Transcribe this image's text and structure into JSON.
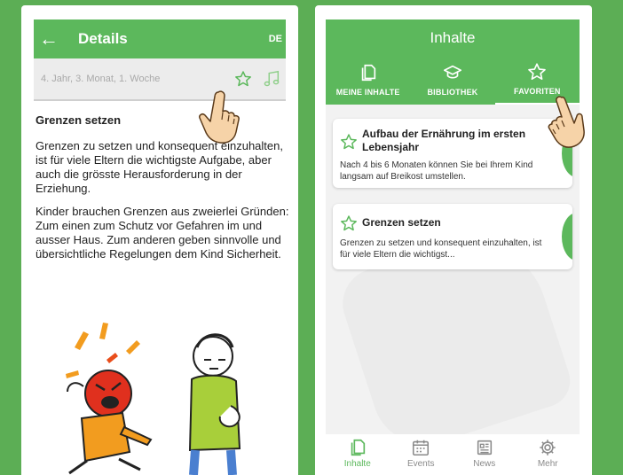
{
  "left_screen": {
    "header": {
      "title": "Details",
      "lang": "DE",
      "back_icon": "arrow-left-icon"
    },
    "age_label": "4. Jahr, 3. Monat, 1. Woche",
    "article": {
      "title": "Grenzen setzen",
      "paragraph1": "Grenzen zu setzen und konsequent einzuhalten, ist für viele Eltern die wichtigste Aufgabe, aber auch die grösste Herausforderung in der Erziehung.",
      "paragraph2": "Kinder brauchen Grenzen aus zweierlei Gründen: Zum einen zum Schutz vor Gefahren im und ausser Haus. Zum anderen geben sinnvolle und übersichtliche Regelungen dem Kind Sicherheit."
    }
  },
  "right_screen": {
    "header": {
      "title": "Inhalte"
    },
    "tabs": [
      {
        "label": "MEINE INHALTE",
        "icon": "documents-icon"
      },
      {
        "label": "BIBLIOTHEK",
        "icon": "graduation-cap-icon"
      },
      {
        "label": "FAVORITEN",
        "icon": "star-icon"
      }
    ],
    "cards": [
      {
        "title": "Aufbau der Ernährung im ersten Lebensjahr",
        "text": "Nach 4 bis 6 Monaten können Sie bei Ihrem Kind langsam auf Breikost umstellen."
      },
      {
        "title": "Grenzen setzen",
        "text": "Grenzen zu setzen und konsequent einzuhalten, ist für viele Eltern die wichtigst..."
      }
    ],
    "nav": [
      {
        "label": "Inhalte",
        "icon": "documents-icon"
      },
      {
        "label": "Events",
        "icon": "calendar-icon"
      },
      {
        "label": "News",
        "icon": "newspaper-icon"
      },
      {
        "label": "Mehr",
        "icon": "gear-icon"
      }
    ]
  },
  "colors": {
    "background": "#5cae55",
    "accent": "#5cb85c"
  }
}
